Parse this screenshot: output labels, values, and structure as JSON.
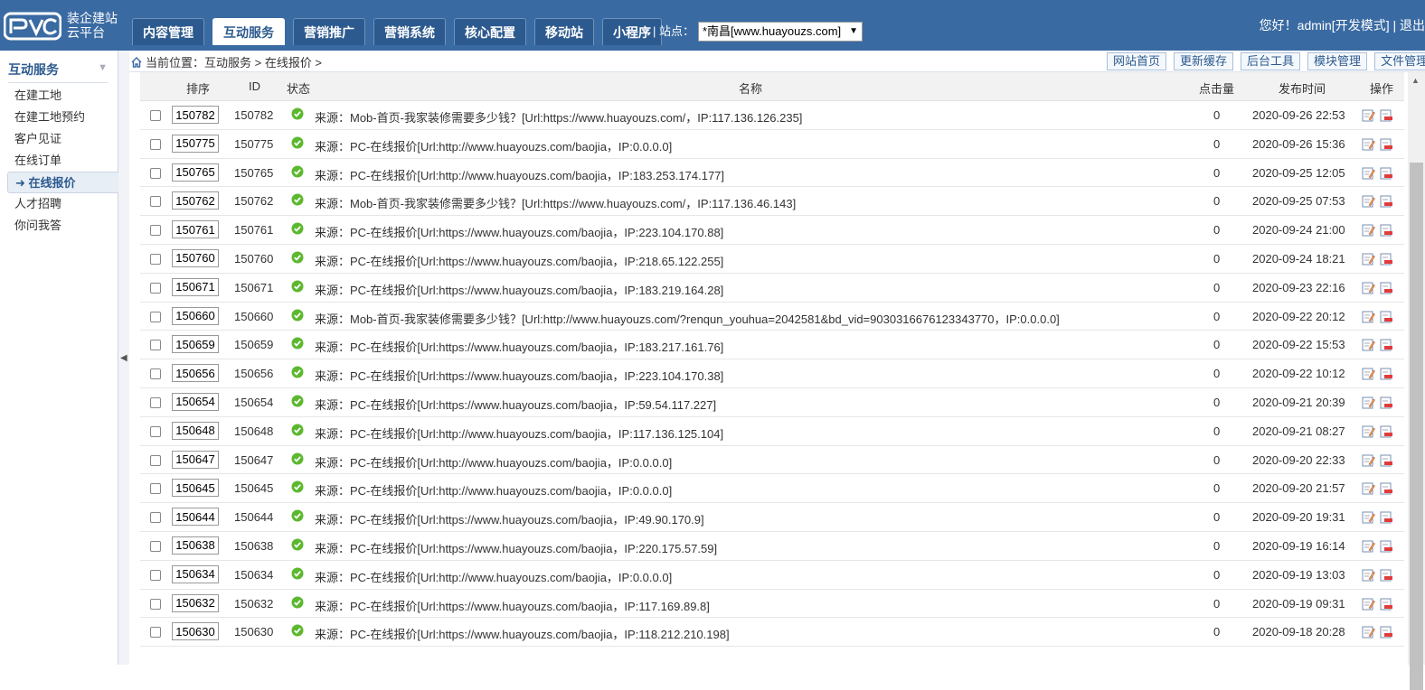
{
  "header": {
    "logo_line1": "装企建站",
    "logo_line2": "云平台",
    "tabs": [
      {
        "label": "内容管理",
        "active": false
      },
      {
        "label": "互动服务",
        "active": true
      },
      {
        "label": "营销推广",
        "active": false
      },
      {
        "label": "营销系统",
        "active": false
      },
      {
        "label": "核心配置",
        "active": false
      },
      {
        "label": "移动站",
        "active": false
      },
      {
        "label": "小程序",
        "active": false
      }
    ],
    "site_label": "| 站点：",
    "site_value": "*南昌[www.huayouzs.com]",
    "user_text": "您好！admin[开发模式] | 退出"
  },
  "sidebar": {
    "title": "互动服务",
    "items": [
      {
        "label": "在建工地",
        "active": false
      },
      {
        "label": "在建工地预约",
        "active": false
      },
      {
        "label": "客户见证",
        "active": false
      },
      {
        "label": "在线订单",
        "active": false
      },
      {
        "label": "在线报价",
        "active": true
      },
      {
        "label": "人才招聘",
        "active": false
      },
      {
        "label": "你问我答",
        "active": false
      }
    ]
  },
  "breadcrumb": {
    "text": "当前位置：互动服务 > 在线报价 >"
  },
  "tools": [
    "网站首页",
    "更新缓存",
    "后台工具",
    "模块管理",
    "文件管理"
  ],
  "table": {
    "headers": {
      "sort": "排序",
      "id": "ID",
      "status": "状态",
      "name": "名称",
      "hits": "点击量",
      "time": "发布时间",
      "ops": "操作"
    },
    "rows": [
      {
        "sort": "150782",
        "id": "150782",
        "name": "来源：Mob-首页-我家装修需要多少钱？[Url:https://www.huayouzs.com/，IP:117.136.126.235]",
        "hits": "0",
        "time": "2020-09-26 22:53"
      },
      {
        "sort": "150775",
        "id": "150775",
        "name": "来源：PC-在线报价[Url:http://www.huayouzs.com/baojia，IP:0.0.0.0]",
        "hits": "0",
        "time": "2020-09-26 15:36"
      },
      {
        "sort": "150765",
        "id": "150765",
        "name": "来源：PC-在线报价[Url:http://www.huayouzs.com/baojia，IP:183.253.174.177]",
        "hits": "0",
        "time": "2020-09-25 12:05"
      },
      {
        "sort": "150762",
        "id": "150762",
        "name": "来源：Mob-首页-我家装修需要多少钱？[Url:https://www.huayouzs.com/，IP:117.136.46.143]",
        "hits": "0",
        "time": "2020-09-25 07:53"
      },
      {
        "sort": "150761",
        "id": "150761",
        "name": "来源：PC-在线报价[Url:https://www.huayouzs.com/baojia，IP:223.104.170.88]",
        "hits": "0",
        "time": "2020-09-24 21:00"
      },
      {
        "sort": "150760",
        "id": "150760",
        "name": "来源：PC-在线报价[Url:https://www.huayouzs.com/baojia，IP:218.65.122.255]",
        "hits": "0",
        "time": "2020-09-24 18:21"
      },
      {
        "sort": "150671",
        "id": "150671",
        "name": "来源：PC-在线报价[Url:https://www.huayouzs.com/baojia，IP:183.219.164.28]",
        "hits": "0",
        "time": "2020-09-23 22:16"
      },
      {
        "sort": "150660",
        "id": "150660",
        "name": "来源：Mob-首页-我家装修需要多少钱？[Url:http://www.huayouzs.com/?renqun_youhua=2042581&bd_vid=9030316676123343770，IP:0.0.0.0]",
        "hits": "0",
        "time": "2020-09-22 20:12"
      },
      {
        "sort": "150659",
        "id": "150659",
        "name": "来源：PC-在线报价[Url:https://www.huayouzs.com/baojia，IP:183.217.161.76]",
        "hits": "0",
        "time": "2020-09-22 15:53"
      },
      {
        "sort": "150656",
        "id": "150656",
        "name": "来源：PC-在线报价[Url:https://www.huayouzs.com/baojia，IP:223.104.170.38]",
        "hits": "0",
        "time": "2020-09-22 10:12"
      },
      {
        "sort": "150654",
        "id": "150654",
        "name": "来源：PC-在线报价[Url:https://www.huayouzs.com/baojia，IP:59.54.117.227]",
        "hits": "0",
        "time": "2020-09-21 20:39"
      },
      {
        "sort": "150648",
        "id": "150648",
        "name": "来源：PC-在线报价[Url:http://www.huayouzs.com/baojia，IP:117.136.125.104]",
        "hits": "0",
        "time": "2020-09-21 08:27"
      },
      {
        "sort": "150647",
        "id": "150647",
        "name": "来源：PC-在线报价[Url:http://www.huayouzs.com/baojia，IP:0.0.0.0]",
        "hits": "0",
        "time": "2020-09-20 22:33"
      },
      {
        "sort": "150645",
        "id": "150645",
        "name": "来源：PC-在线报价[Url:http://www.huayouzs.com/baojia，IP:0.0.0.0]",
        "hits": "0",
        "time": "2020-09-20 21:57"
      },
      {
        "sort": "150644",
        "id": "150644",
        "name": "来源：PC-在线报价[Url:https://www.huayouzs.com/baojia，IP:49.90.170.9]",
        "hits": "0",
        "time": "2020-09-20 19:31"
      },
      {
        "sort": "150638",
        "id": "150638",
        "name": "来源：PC-在线报价[Url:https://www.huayouzs.com/baojia，IP:220.175.57.59]",
        "hits": "0",
        "time": "2020-09-19 16:14"
      },
      {
        "sort": "150634",
        "id": "150634",
        "name": "来源：PC-在线报价[Url:http://www.huayouzs.com/baojia，IP:0.0.0.0]",
        "hits": "0",
        "time": "2020-09-19 13:03"
      },
      {
        "sort": "150632",
        "id": "150632",
        "name": "来源：PC-在线报价[Url:https://www.huayouzs.com/baojia，IP:117.169.89.8]",
        "hits": "0",
        "time": "2020-09-19 09:31"
      },
      {
        "sort": "150630",
        "id": "150630",
        "name": "来源：PC-在线报价[Url:https://www.huayouzs.com/baojia，IP:118.212.210.198]",
        "hits": "0",
        "time": "2020-09-18 20:28"
      }
    ]
  },
  "icons": {
    "status": "check-circle-icon",
    "edit": "edit-icon",
    "delete": "delete-icon",
    "home": "home-icon"
  },
  "colors": {
    "header_bg": "#3a6aa2",
    "accent": "#2d5a8e",
    "status_ok": "#5cb82f"
  }
}
